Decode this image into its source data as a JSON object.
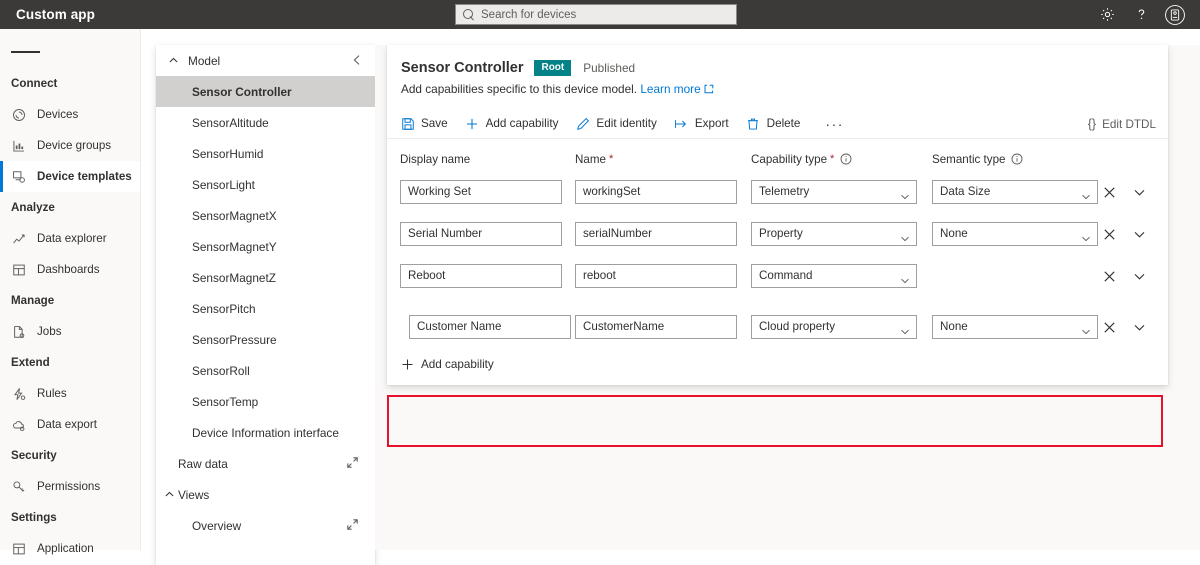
{
  "topbar": {
    "app_title": "Custom app",
    "search_placeholder": "Search for devices",
    "settings_icon": "gear-icon",
    "help_icon": "question-mark-icon",
    "account_icon": "account-avatar-icon"
  },
  "sidebar": {
    "menu_icon": "hamburger-menu-icon",
    "groups": [
      {
        "label": "Connect",
        "items": [
          {
            "label": "Devices",
            "icon": "devices-icon",
            "selected": false
          },
          {
            "label": "Device groups",
            "icon": "device-groups-icon",
            "selected": false
          },
          {
            "label": "Device templates",
            "icon": "device-templates-icon",
            "selected": true
          }
        ]
      },
      {
        "label": "Analyze",
        "items": [
          {
            "label": "Data explorer",
            "icon": "line-chart-icon",
            "selected": false
          },
          {
            "label": "Dashboards",
            "icon": "dashboard-grid-icon",
            "selected": false
          }
        ]
      },
      {
        "label": "Manage",
        "items": [
          {
            "label": "Jobs",
            "icon": "jobs-document-icon",
            "selected": false
          }
        ]
      },
      {
        "label": "Extend",
        "items": [
          {
            "label": "Rules",
            "icon": "rules-icon",
            "selected": false
          },
          {
            "label": "Data export",
            "icon": "cloud-export-icon",
            "selected": false
          }
        ]
      },
      {
        "label": "Security",
        "items": [
          {
            "label": "Permissions",
            "icon": "key-icon",
            "selected": false
          }
        ]
      },
      {
        "label": "Settings",
        "items": [
          {
            "label": "Application",
            "icon": "application-grid-icon",
            "selected": false
          }
        ]
      }
    ]
  },
  "tree": {
    "header": "Model",
    "collapse_icon": "chevron-left-icon",
    "nodes": [
      {
        "label": "Sensor Controller",
        "selected": true,
        "level": 2,
        "expand": false
      },
      {
        "label": "SensorAltitude",
        "selected": false,
        "level": 2,
        "expand": false
      },
      {
        "label": "SensorHumid",
        "selected": false,
        "level": 2,
        "expand": false
      },
      {
        "label": "SensorLight",
        "selected": false,
        "level": 2,
        "expand": false
      },
      {
        "label": "SensorMagnetX",
        "selected": false,
        "level": 2,
        "expand": false
      },
      {
        "label": "SensorMagnetY",
        "selected": false,
        "level": 2,
        "expand": false
      },
      {
        "label": "SensorMagnetZ",
        "selected": false,
        "level": 2,
        "expand": false
      },
      {
        "label": "SensorPitch",
        "selected": false,
        "level": 2,
        "expand": false
      },
      {
        "label": "SensorPressure",
        "selected": false,
        "level": 2,
        "expand": false
      },
      {
        "label": "SensorRoll",
        "selected": false,
        "level": 2,
        "expand": false
      },
      {
        "label": "SensorTemp",
        "selected": false,
        "level": 2,
        "expand": false
      },
      {
        "label": "Device Information interface",
        "selected": false,
        "level": 2,
        "expand": false
      },
      {
        "label": "Raw data",
        "selected": false,
        "level": 1,
        "expand": true
      },
      {
        "label": "Views",
        "selected": false,
        "level": 1,
        "expand": false,
        "chevron": true
      },
      {
        "label": "Overview",
        "selected": false,
        "level": 2,
        "expand": true
      }
    ]
  },
  "main": {
    "title": "Sensor Controller",
    "badge": "Root",
    "status": "Published",
    "subtitle": "Add capabilities specific to this device model.",
    "learn_more": "Learn more",
    "toolbar": {
      "save": "Save",
      "add_capability": "Add capability",
      "edit_identity": "Edit identity",
      "export": "Export",
      "delete": "Delete",
      "overflow": "···",
      "edit_dtdl": "Edit DTDL",
      "braces": "{}"
    },
    "table": {
      "headers": {
        "display_name": "Display name",
        "name": "Name",
        "capability_type": "Capability type",
        "semantic_type": "Semantic type",
        "required_marker": "*"
      },
      "rows": [
        {
          "display_name": "Working Set",
          "name": "workingSet",
          "capability_type": "Telemetry",
          "semantic_type": "Data Size",
          "has_semantic": true,
          "highlighted": false
        },
        {
          "display_name": "Serial Number",
          "name": "serialNumber",
          "capability_type": "Property",
          "semantic_type": "None",
          "has_semantic": true,
          "highlighted": false
        },
        {
          "display_name": "Reboot",
          "name": "reboot",
          "capability_type": "Command",
          "semantic_type": "",
          "has_semantic": false,
          "highlighted": false
        },
        {
          "display_name": "Customer Name",
          "name": "CustomerName",
          "capability_type": "Cloud property",
          "semantic_type": "None",
          "has_semantic": true,
          "highlighted": true
        }
      ]
    },
    "add_capability_label": "Add capability"
  },
  "colors": {
    "accent": "#0078d4",
    "topbar_bg": "#3b3a39",
    "badge_teal": "#038387",
    "highlight_red": "#e8112d",
    "required_red": "#a4262c",
    "tree_selected": "#d2d0ce"
  }
}
